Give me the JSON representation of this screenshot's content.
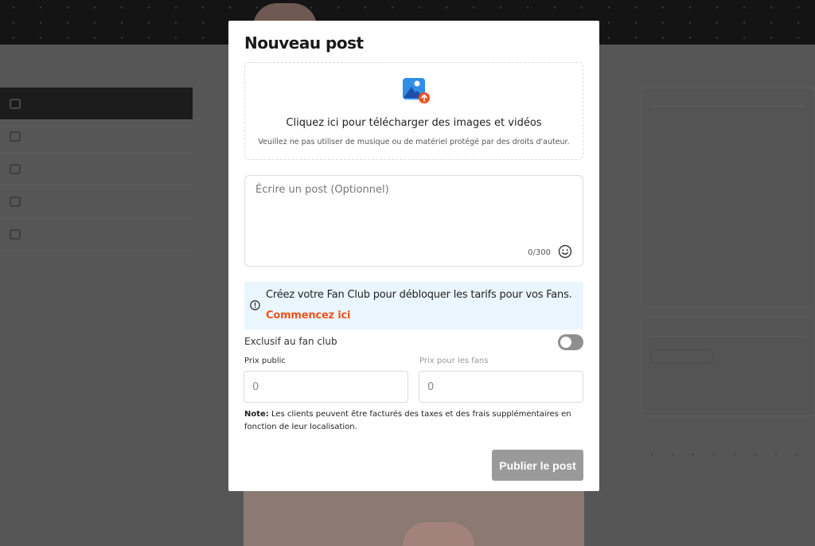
{
  "modal": {
    "title": "Nouveau post",
    "upload": {
      "icon": "image-upload-icon",
      "title": "Cliquez ici pour télécharger des images et vidéos",
      "note": "Veuillez ne pas utiliser de musique ou de matériel protégé par des droits d'auteur."
    },
    "post": {
      "placeholder": "Écrire un post (Optionnel)",
      "value": "",
      "counter": "0/300",
      "emoji_icon": "smiley-icon"
    },
    "fanclub_banner": {
      "icon": "info-icon",
      "text": "Créez votre Fan Club pour débloquer les tarifs pour vos Fans.",
      "link": "Commencez ici",
      "background": "#eaf6fd",
      "link_color": "#f0531f"
    },
    "exclusive": {
      "label": "Exclusif au fan club",
      "enabled": false
    },
    "public_price": {
      "label": "Prix public",
      "placeholder": "0"
    },
    "fans_price": {
      "label": "Prix pour les fans",
      "placeholder": "0"
    },
    "note": {
      "prefix": "Note:",
      "text": " Les clients peuvent être facturés des taxes et des frais supplémentaires en fonction de leur localisation."
    },
    "publish_button": "Publier le post",
    "publish_button_color": "#9a9a9a"
  }
}
